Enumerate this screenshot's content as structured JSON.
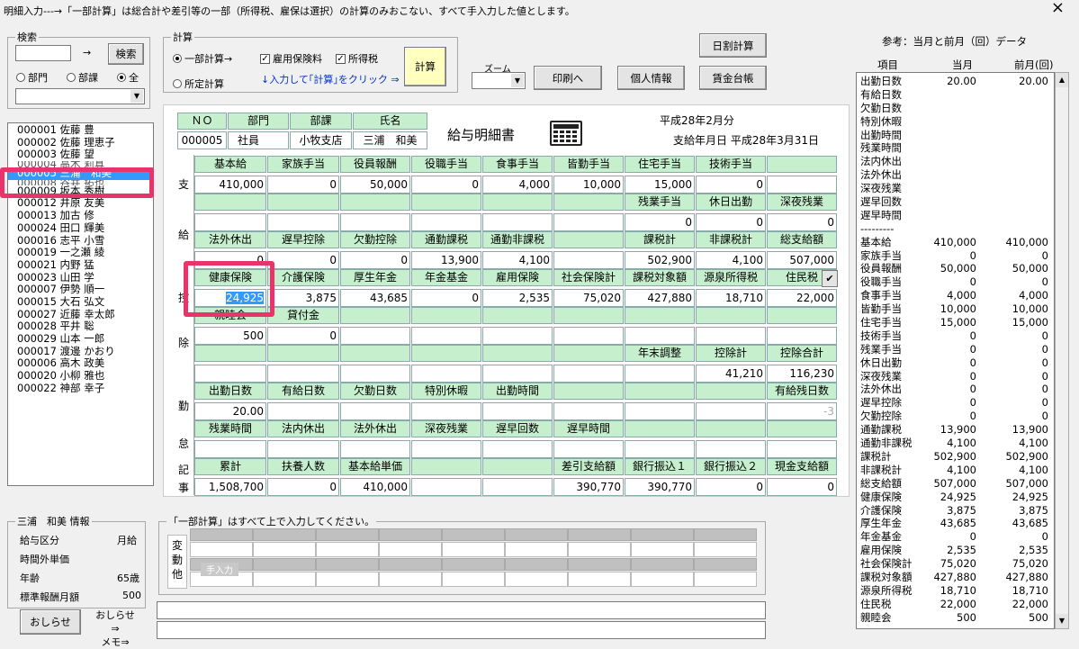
{
  "title": "明細入力---→「一部計算」は総合計や差引等の一部（所得税、雇保は選択）の計算のみおこない、すべて手入力した値とします。",
  "close": "×",
  "search": {
    "legend": "検索",
    "arrow": "→",
    "button": "検索",
    "radios": [
      "部門",
      "部課",
      "全"
    ],
    "selected": "全"
  },
  "calc": {
    "legend": "計算",
    "radio1": "一部計算→",
    "radio2": "所定計算",
    "cb1": "雇用保険料",
    "cb2": "所得税",
    "hint": "↓入力して｢計算｣をクリック ⇒",
    "button": "計算"
  },
  "zoom_label": "ズーム",
  "buttons": {
    "daily": "日割計算",
    "print": "印刷へ",
    "personal": "個人情報",
    "ledger": "賃金台帳",
    "notice": "おしらせ",
    "notice_memo": "おしらせ⇒\nメモ⇒"
  },
  "employees": [
    "000001 佐藤 豊",
    "000002 佐藤 理恵子",
    "000003 佐藤 望",
    "000004 高木 莉真",
    "000005 三浦　和美",
    "000008 谷井 拓也",
    "000009 坂本 秀樹",
    "000012 井原 友美",
    "000013 加古 修",
    "000024 田口 輝美",
    "000016 志平 小雪",
    "000019 一之瀬 綾",
    "000021 内野 猛",
    "000023 山田 学",
    "000007 伊勢 順一",
    "000015 大石 弘文",
    "000027 近藤 幸太郎",
    "000028 平井 聡",
    "000029 山本 一郎",
    "000017 渡邊 かおり",
    "000006 高木 政美",
    "000020 小柳 雅也",
    "000022 神部 幸子"
  ],
  "selected_employee": "000005 三浦　和美",
  "header": {
    "no_label": "ＮＯ",
    "dept_label": "部門",
    "section_label": "部課",
    "name_label": "氏名",
    "no": "000005",
    "dept": "社員",
    "section": "小牧支店",
    "name": "三浦　和美",
    "doc_title": "給与明細書",
    "period": "平成28年2月分",
    "pay_date": "支給年月日 平成28年3月31日"
  },
  "sides": {
    "pay1": "支",
    "pay2": "給",
    "ded1": "控",
    "ded2": "除",
    "att1": "勤",
    "att2": "怠",
    "rec1": "記",
    "rec2": "事"
  },
  "pay_head1": [
    "基本給",
    "家族手当",
    "役員報酬",
    "役職手当",
    "食事手当",
    "皆勤手当",
    "住宅手当",
    "技術手当",
    ""
  ],
  "pay_val1": [
    "410,000",
    "0",
    "50,000",
    "0",
    "4,000",
    "10,000",
    "15,000",
    "0",
    ""
  ],
  "pay_head2": [
    "",
    "",
    "",
    "",
    "",
    "",
    "残業手当",
    "休日出勤",
    "深夜残業"
  ],
  "pay_val2": [
    "",
    "",
    "",
    "",
    "",
    "",
    "0",
    "0",
    "0"
  ],
  "pay_head3": [
    "法外休出",
    "遅早控除",
    "欠勤控除",
    "通勤課税",
    "通勤非課税",
    "",
    "課税計",
    "非課税計",
    "総支給額"
  ],
  "pay_val3": [
    "0",
    "0",
    "0",
    "13,900",
    "4,100",
    "",
    "502,900",
    "4,100",
    "507,000"
  ],
  "ded_head1": [
    "健康保険",
    "介護保険",
    "厚生年金",
    "年金基金",
    "雇用保険",
    "社会保険計",
    "課税対象額",
    "源泉所得税",
    "住民税"
  ],
  "ded_val1": [
    "24,925",
    "3,875",
    "43,685",
    "0",
    "2,535",
    "75,020",
    "427,880",
    "18,710",
    "22,000"
  ],
  "ded_head2": [
    "親睦会",
    "貸付金",
    "",
    "",
    "",
    "",
    "",
    "",
    ""
  ],
  "ded_val2": [
    "500",
    "0",
    "",
    "",
    "",
    "",
    "",
    "",
    ""
  ],
  "ded_head3": [
    "",
    "",
    "",
    "",
    "",
    "",
    "年末調整",
    "控除計",
    "控除合計"
  ],
  "ded_val3": [
    "",
    "",
    "",
    "",
    "",
    "",
    "",
    "41,210",
    "116,230"
  ],
  "att_head1": [
    "出勤日数",
    "有給日数",
    "欠勤日数",
    "特別休暇",
    "出勤時間",
    "",
    "",
    "",
    "有給残日数"
  ],
  "att_val1": [
    "20.00",
    "",
    "",
    "",
    "",
    "",
    "",
    "",
    "-3"
  ],
  "att_head2": [
    "残業時間",
    "法内休出",
    "法外休出",
    "深夜残業",
    "遅早回数",
    "遅早時間",
    "",
    "",
    ""
  ],
  "att_val2": [
    "",
    "",
    "",
    "",
    "",
    "",
    "",
    "",
    ""
  ],
  "rec_head": [
    "累計",
    "扶養人数",
    "基本給単価",
    "",
    "",
    "差引支給額",
    "銀行振込１",
    "銀行振込２",
    "現金支給額"
  ],
  "rec_val": [
    "1,508,700",
    "0",
    "410,000",
    "",
    "",
    "390,770",
    "390,770",
    "0",
    "0"
  ],
  "info": {
    "legend": "三浦　和美 情報",
    "rows": [
      [
        "給与区分",
        "月給"
      ],
      [
        "時間外単価",
        ""
      ],
      [
        "年齢",
        "65歳"
      ],
      [
        "標準報酬月額",
        "500"
      ]
    ]
  },
  "bottom": {
    "legend": "「一部計算」はすべて上で入力してください。",
    "side": "変\n動\n他",
    "tegaki": "手入力"
  },
  "reference": {
    "title": "参考：当月と前月（回）データ",
    "col_item": "項目",
    "col_cur": "当月",
    "col_prev": "前月(回)",
    "rows": [
      [
        "出勤日数",
        "20.00",
        "20.00"
      ],
      [
        "有給日数",
        "",
        ""
      ],
      [
        "欠勤日数",
        "",
        ""
      ],
      [
        "特別休暇",
        "",
        ""
      ],
      [
        "出勤時間",
        "",
        ""
      ],
      [
        "残業時間",
        "",
        ""
      ],
      [
        "法内休出",
        "",
        ""
      ],
      [
        "法外休出",
        "",
        ""
      ],
      [
        "深夜残業",
        "",
        ""
      ],
      [
        "遅早回数",
        "",
        ""
      ],
      [
        "遅早時間",
        "",
        ""
      ],
      [
        "---------",
        "",
        ""
      ],
      [
        "基本給",
        "410,000",
        "410,000"
      ],
      [
        "家族手当",
        "0",
        "0"
      ],
      [
        "役員報酬",
        "50,000",
        "50,000"
      ],
      [
        "役職手当",
        "0",
        "0"
      ],
      [
        "食事手当",
        "4,000",
        "4,000"
      ],
      [
        "皆勤手当",
        "10,000",
        "10,000"
      ],
      [
        "住宅手当",
        "15,000",
        "15,000"
      ],
      [
        "技術手当",
        "0",
        "0"
      ],
      [
        "残業手当",
        "0",
        "0"
      ],
      [
        "休日出勤",
        "0",
        "0"
      ],
      [
        "深夜残業",
        "0",
        "0"
      ],
      [
        "法外休出",
        "0",
        "0"
      ],
      [
        "遅早控除",
        "0",
        "0"
      ],
      [
        "欠勤控除",
        "0",
        "0"
      ],
      [
        "通勤課税",
        "13,900",
        "13,900"
      ],
      [
        "通勤非課税",
        "4,100",
        "4,100"
      ],
      [
        "課税計",
        "502,900",
        "502,900"
      ],
      [
        "非課税計",
        "4,100",
        "4,100"
      ],
      [
        "総支給額",
        "507,000",
        "507,000"
      ],
      [
        "健康保険",
        "24,925",
        "24,925"
      ],
      [
        "介護保険",
        "3,875",
        "3,875"
      ],
      [
        "厚生年金",
        "43,685",
        "43,685"
      ],
      [
        "年金基金",
        "0",
        "0"
      ],
      [
        "雇用保険",
        "2,535",
        "2,535"
      ],
      [
        "社会保険計",
        "75,020",
        "75,020"
      ],
      [
        "課税対象額",
        "427,880",
        "427,880"
      ],
      [
        "源泉所得税",
        "18,710",
        "18,710"
      ],
      [
        "住民税",
        "22,000",
        "22,000"
      ],
      [
        "親睦会",
        "500",
        "500"
      ]
    ]
  }
}
